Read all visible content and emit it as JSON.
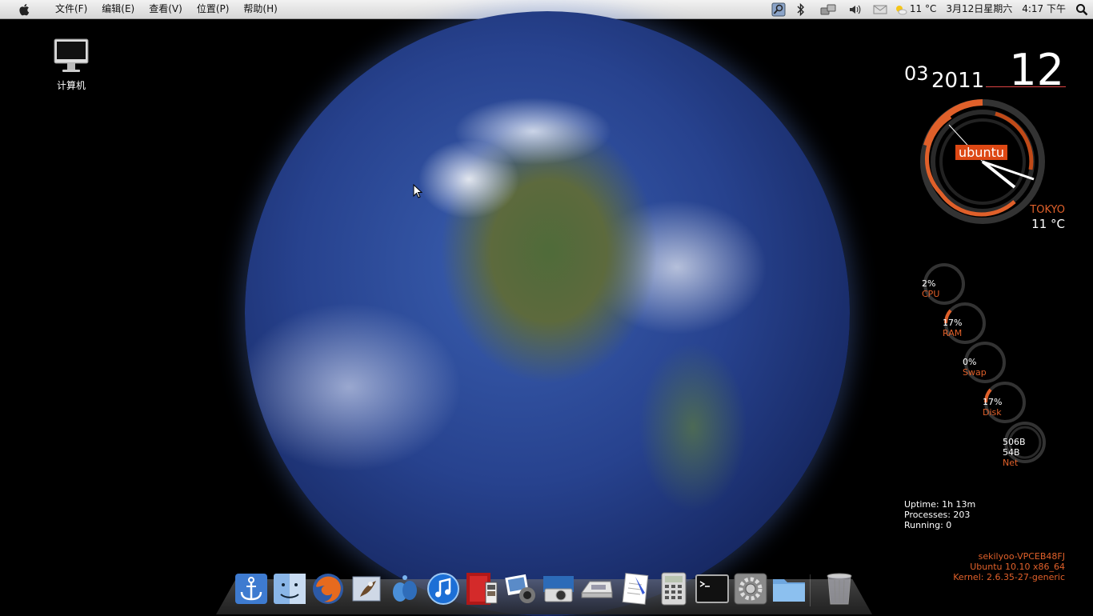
{
  "menubar": {
    "menus": [
      "文件(F)",
      "编辑(E)",
      "查看(V)",
      "位置(P)",
      "帮助(H)"
    ],
    "weather": "11 °C",
    "date": "3月12日星期六",
    "time": "4:17 下午"
  },
  "desktop": {
    "icons": [
      {
        "label": "计算机",
        "icon": "computer-icon"
      }
    ]
  },
  "widgets": {
    "month": "03",
    "year": "2011",
    "day": "12",
    "clock_badge": "ubuntu",
    "city": "TOKYO",
    "temperature": "11 °C",
    "meters": [
      {
        "value": "2%",
        "name": "CPU",
        "level": 0.02
      },
      {
        "value": "17%",
        "name": "RAM",
        "level": 0.17
      },
      {
        "value": "0%",
        "name": "Swap",
        "level": 0.0
      },
      {
        "value": "17%",
        "name": "Disk",
        "level": 0.17
      },
      {
        "value": "506B",
        "value2": "54B",
        "name": "Net",
        "level": 0.05
      }
    ],
    "uptime": "Uptime: 1h 13m",
    "processes": "Processes: 203",
    "running": "Running: 0",
    "hostname": "sekilyoo-VPCEB48FJ",
    "distro": "Ubuntu 10.10  x86_64",
    "kernel": "Kernel: 2.6.35-27-generic"
  },
  "colors": {
    "accent": "#e0602a",
    "ubuntu_orange": "#dd4814"
  },
  "dock": {
    "items": [
      "anchor-icon",
      "finder-icon",
      "firefox-icon",
      "mail-icon",
      "messenger-icon",
      "itunes-icon",
      "photo-booth-icon",
      "iphoto-icon",
      "image-capture-icon",
      "scanner-icon",
      "text-editor-icon",
      "calculator-icon",
      "terminal-icon",
      "system-preferences-icon",
      "folder-icon",
      "trash-icon"
    ]
  }
}
